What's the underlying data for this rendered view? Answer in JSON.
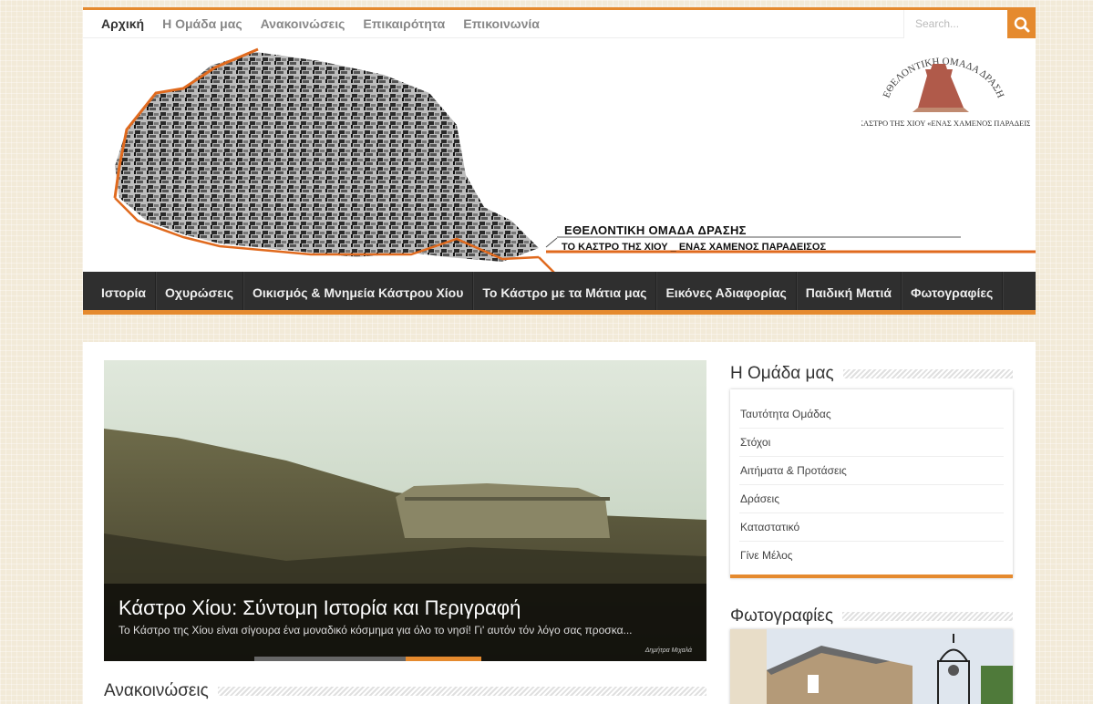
{
  "topnav": {
    "items": [
      {
        "label": "Αρχική",
        "active": true
      },
      {
        "label": "Η Ομάδα μας"
      },
      {
        "label": "Ανακοινώσεις"
      },
      {
        "label": "Επικαιρότητα"
      },
      {
        "label": "Επικοινωνία"
      }
    ],
    "search_placeholder": "Search..."
  },
  "banner": {
    "tagline1": "ΕΘΕΛΟΝΤΙΚΗ ΟΜΑΔΑ ΔΡΑΣΗΣ",
    "tagline2": "ΤΟ ΚΑΣΤΡΟ ΤΗΣ ΧΙΟΥ _ ΕΝΑΣ ΧΑΜΕΝΟΣ ΠΑΡΑΔΕΙΣΟΣ",
    "logo_arc": "ΕΘΕΛΟΝΤΙΚΗ ΟΜΑΔΑ ΔΡΑΣΗΣ",
    "logo_caption": "ΤΟ ΚΑΣΤΡΟ ΤΗΣ ΧΙΟΥ «ΕΝΑΣ ΧΑΜΕΝΟΣ ΠΑΡΑΔΕΙΣΟΣ»"
  },
  "mainnav": {
    "items": [
      "Ιστορία",
      "Οχυρώσεις",
      "Οικισμός & Μνημεία Κάστρου Χίου",
      "Το Κάστρο με τα Μάτια μας",
      "Εικόνες Αδιαφορίας",
      "Παιδική Ματιά",
      "Φωτογραφίες"
    ]
  },
  "slider": {
    "title": "Κάστρο Χίου: Σύντομη Ιστορία και Περιγραφή",
    "excerpt": "Το Κάστρο της Χίου είναι σίγουρα ένα μοναδικό κόσμημα για όλο το νησί! Γι' αυτόν τόν λόγο σας προσκα...",
    "credit": "Δημήτρα Μιχαλά",
    "active_slide": 3
  },
  "sections": {
    "announcements": "Ανακοινώσεις",
    "team": "Η Ομάδα μας",
    "photos": "Φωτογραφίες"
  },
  "team_widget": {
    "items": [
      "Ταυτότητα Ομάδας",
      "Στόχοι",
      "Αιτήματα & Προτάσεις",
      "Δράσεις",
      "Καταστατικό",
      "Γίνε Μέλος"
    ]
  },
  "colors": {
    "accent": "#e58a2e",
    "nav_bg": "#2f2f2f"
  }
}
